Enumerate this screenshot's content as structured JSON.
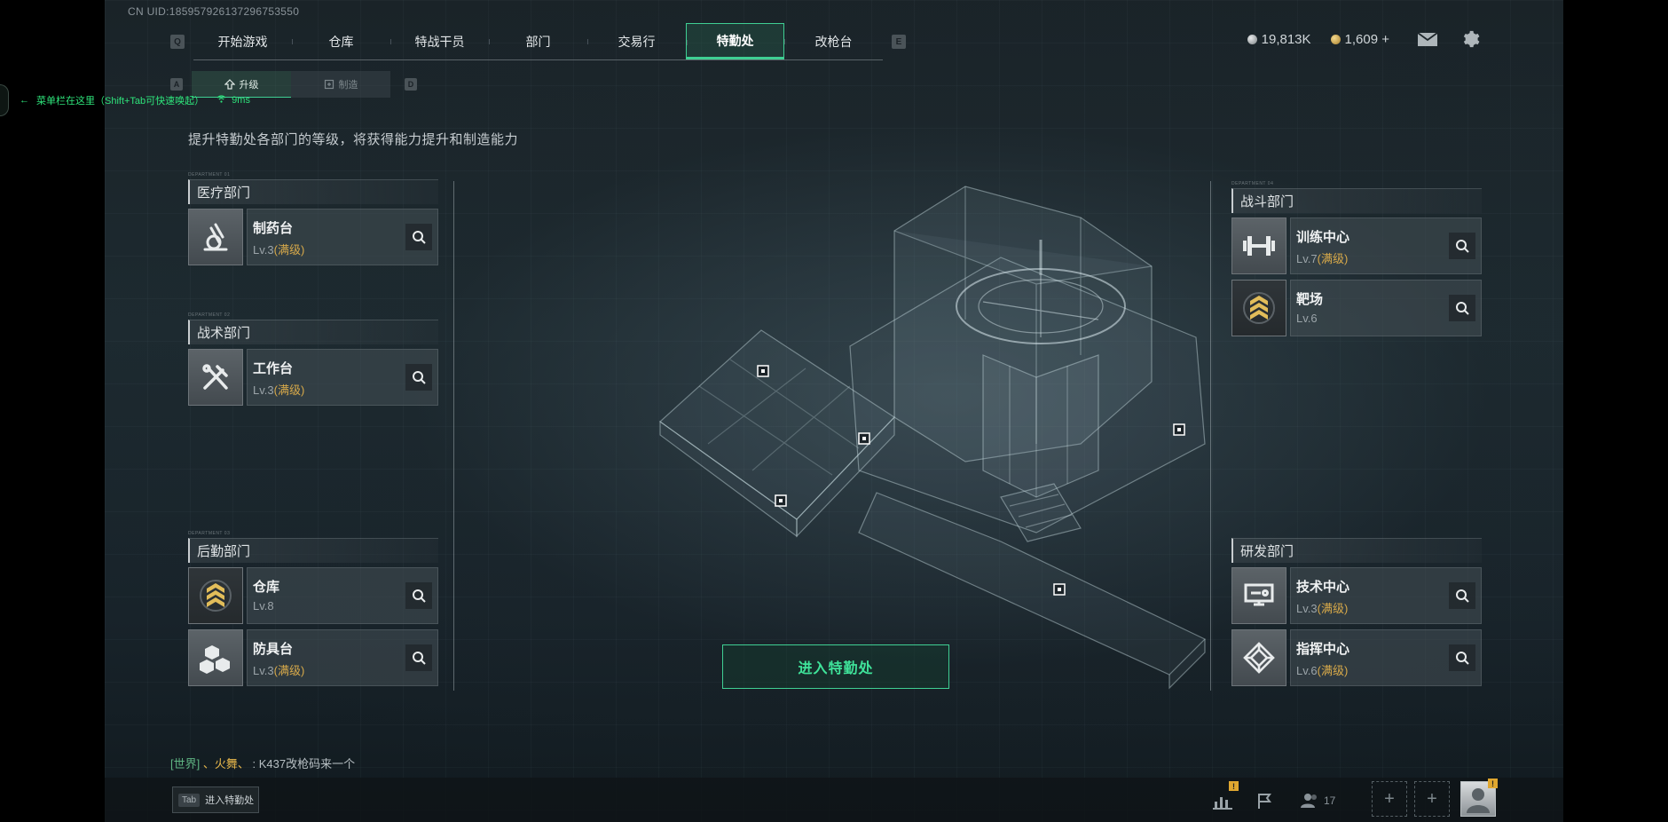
{
  "uid": "CN UID:1859579261372967535​50",
  "nav": {
    "left_key": "Q",
    "right_key": "E",
    "tabs": [
      "开始游戏",
      "仓库",
      "特战干员",
      "部门",
      "交易行",
      "特勤处",
      "改枪台"
    ],
    "active": "特勤处"
  },
  "currency": {
    "silver": "19,813K",
    "gold": "1,609 +"
  },
  "subnav": {
    "left_key": "A",
    "right_key": "D",
    "upgrade": "升级",
    "craft": "制造"
  },
  "hint": {
    "text": "菜单栏在这里（Shift+Tab可快速唤起）",
    "ping": "9ms"
  },
  "description": "提升特勤处各部门的等级，将获得能力提升和制造能力",
  "departments": {
    "medical": {
      "tag": "DEPARTMENT 01",
      "title": "医疗部门",
      "items": [
        {
          "name": "制药台",
          "level": "Lv.3",
          "max": "(满级)",
          "icon": "microscope-icon"
        }
      ]
    },
    "tactical": {
      "tag": "DEPARTMENT 02",
      "title": "战术部门",
      "items": [
        {
          "name": "工作台",
          "level": "Lv.3",
          "max": "(满级)",
          "icon": "hammer-wrench-icon"
        }
      ]
    },
    "logistics": {
      "tag": "DEPARTMENT 03",
      "title": "后勤部门",
      "items": [
        {
          "name": "仓库",
          "level": "Lv.8",
          "icon": "chevron-rank-icon"
        },
        {
          "name": "防具台",
          "level": "Lv.3",
          "max": "(满级)",
          "icon": "boxes-icon"
        }
      ]
    },
    "combat": {
      "tag": "DEPARTMENT 04",
      "title": "战斗部门",
      "items": [
        {
          "name": "训练中心",
          "level": "Lv.7",
          "max": "(满级)",
          "icon": "dumbbell-icon"
        },
        {
          "name": "靶场",
          "level": "Lv.6",
          "icon": "chevron-rank-icon"
        }
      ]
    },
    "research": {
      "title": "研发部门",
      "items": [
        {
          "name": "技术中心",
          "level": "Lv.3",
          "max": "(满级)",
          "icon": "tech-terminal-icon"
        },
        {
          "name": "指挥中心",
          "level": "Lv.6",
          "max": "(满级)",
          "icon": "command-emblem-icon"
        }
      ]
    }
  },
  "enter_button": "进入特勤处",
  "chat": {
    "channel": "[世界]",
    "sender": "、火舞、",
    "message": ": K437改枪码来一个"
  },
  "tab_hint": {
    "key": "Tab",
    "label": "进入特勤处"
  },
  "party_count": "17",
  "colors": {
    "accent": "#3fcf93",
    "max_level": "#d7a94a",
    "badge": "#e0a730"
  }
}
